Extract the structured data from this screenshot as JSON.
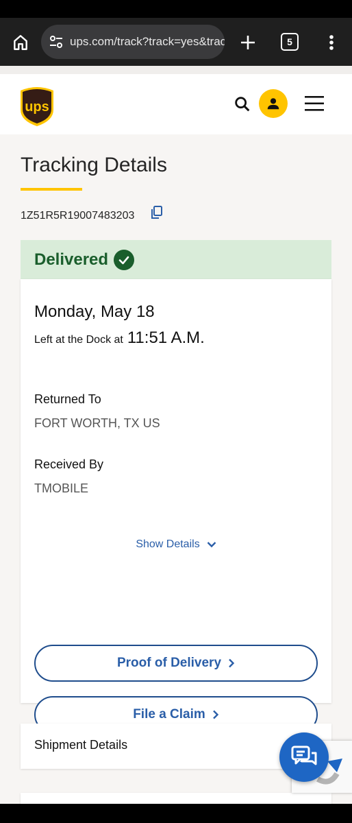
{
  "browser": {
    "url": "ups.com/track?track=yes&trac",
    "tab_count": "5"
  },
  "colors": {
    "ups_brown": "#351c15",
    "ups_gold": "#ffc400",
    "delivered_green": "#1a5e2c",
    "delivered_bg": "#d9ecd9",
    "link_blue": "#2a5ea8"
  },
  "header": {
    "logo_icon": "ups-shield-logo",
    "search_icon": "search-icon",
    "account_icon": "account-icon",
    "menu_icon": "hamburger-menu-icon"
  },
  "tracking": {
    "title": "Tracking Details",
    "number": "1Z51R5R19007483203",
    "status": "Delivered",
    "date": "Monday, May 18",
    "left_at_label": "Left at the Dock at",
    "left_at_time": "11:51 A.M.",
    "returned_to_label": "Returned To",
    "returned_to_value": "FORT WORTH, TX US",
    "received_by_label": "Received By",
    "received_by_value": "TMOBILE",
    "show_details": "Show Details",
    "proof_of_delivery": "Proof of Delivery",
    "file_claim": "File a Claim"
  },
  "shipment": {
    "title": "Shipment Details"
  }
}
